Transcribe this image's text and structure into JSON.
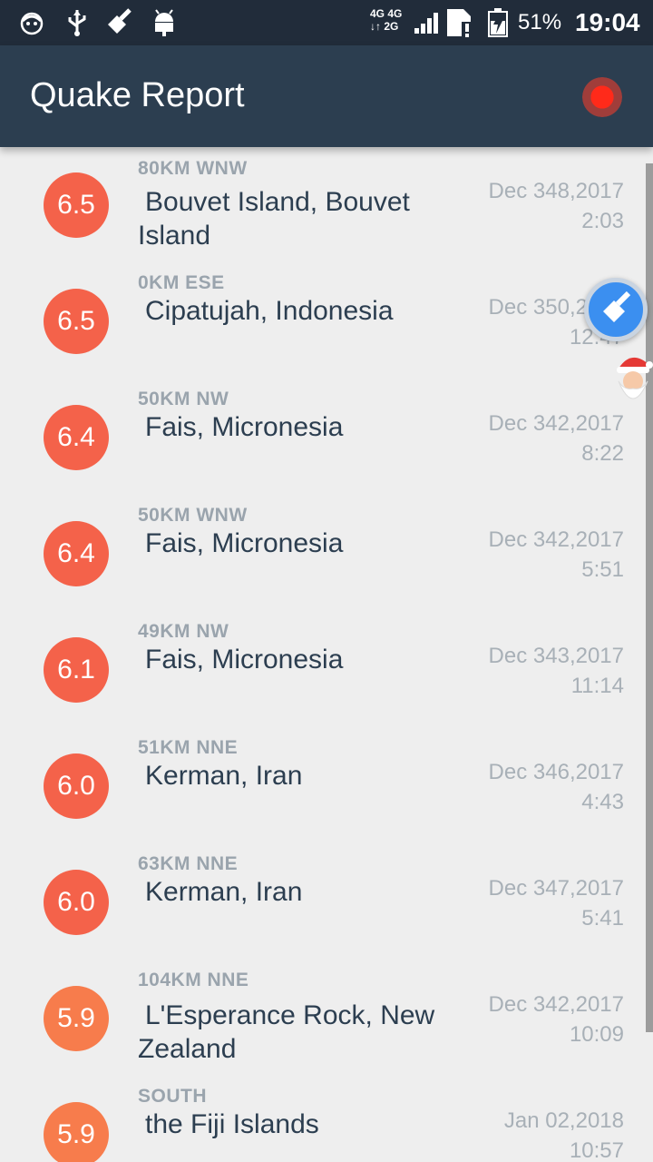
{
  "statusbar": {
    "battery": "51%",
    "time": "19:04",
    "network_top": "4G 4G",
    "network_bottom": "↓↑ 2G"
  },
  "appbar": {
    "title": "Quake Report"
  },
  "quakes": [
    {
      "mag": "6.5",
      "offset": "80KM WNW",
      "place": "Bouvet Island, Bouvet Island",
      "date": "Dec 348,2017",
      "time": "2:03",
      "color": "#f4624a"
    },
    {
      "mag": "6.5",
      "offset": "0KM ESE",
      "place": "Cipatujah, Indonesia",
      "date": "Dec 350,2017",
      "time": "12:47",
      "color": "#f4624a"
    },
    {
      "mag": "6.4",
      "offset": "50KM NW",
      "place": "Fais, Micronesia",
      "date": "Dec 342,2017",
      "time": "8:22",
      "color": "#f4624a"
    },
    {
      "mag": "6.4",
      "offset": "50KM WNW",
      "place": "Fais, Micronesia",
      "date": "Dec 342,2017",
      "time": "5:51",
      "color": "#f4624a"
    },
    {
      "mag": "6.1",
      "offset": "49KM NW",
      "place": "Fais, Micronesia",
      "date": "Dec 343,2017",
      "time": "11:14",
      "color": "#f4624a"
    },
    {
      "mag": "6.0",
      "offset": "51KM NNE",
      "place": "Kerman, Iran",
      "date": "Dec 346,2017",
      "time": "4:43",
      "color": "#f4624a"
    },
    {
      "mag": "6.0",
      "offset": "63KM NNE",
      "place": "Kerman, Iran",
      "date": "Dec 347,2017",
      "time": "5:41",
      "color": "#f4624a"
    },
    {
      "mag": "5.9",
      "offset": "104KM NNE",
      "place": "L'Esperance Rock, New Zealand",
      "date": "Dec 342,2017",
      "time": "10:09",
      "color": "#f77c4c"
    },
    {
      "mag": "5.9",
      "offset": "SOUTH",
      "place": "the Fiji Islands",
      "date": "Jan 02,2018",
      "time": "10:57",
      "color": "#f77c4c"
    }
  ]
}
